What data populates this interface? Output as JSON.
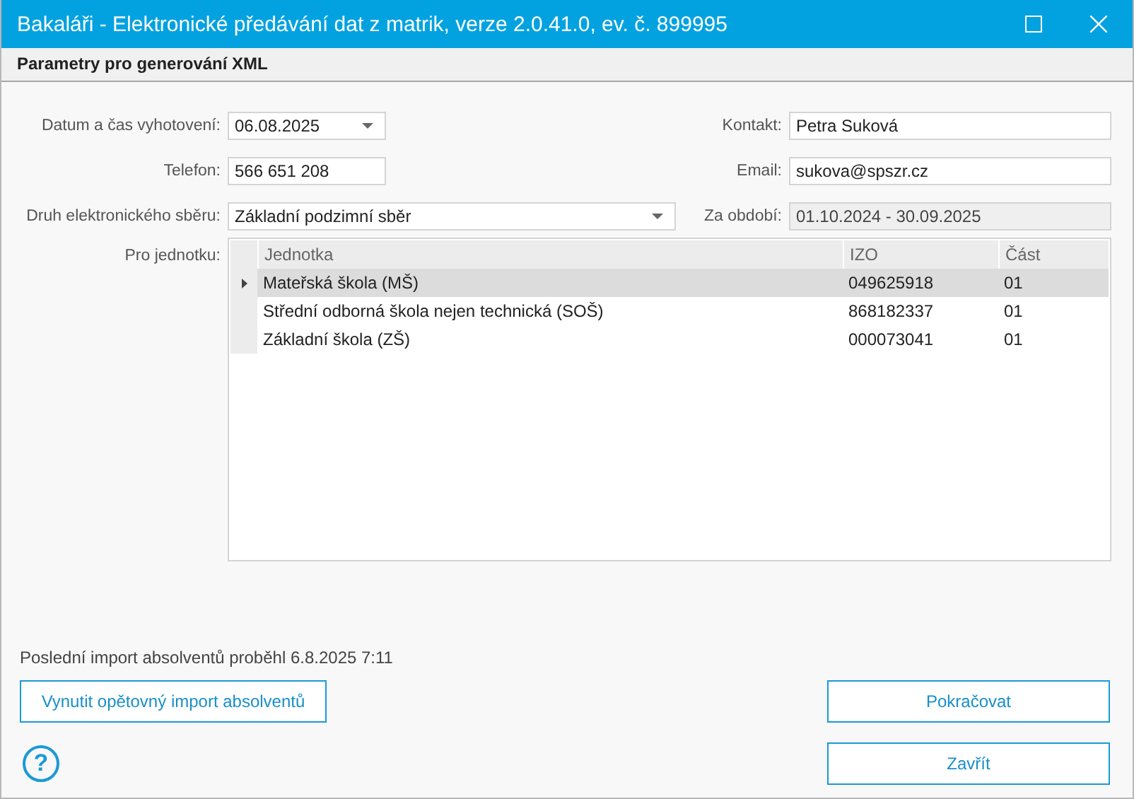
{
  "window": {
    "title": "Bakaláři - Elektronické předávání dat z matrik, verze 2.0.41.0, ev. č. 899995"
  },
  "tabs": [
    {
      "label": "Parametry pro generování XML",
      "selected": true
    }
  ],
  "form": {
    "date_label": "Datum a čas vyhotovení:",
    "date_value": "06.08.2025",
    "contact_label": "Kontakt:",
    "contact_value": "Petra Suková",
    "phone_label": "Telefon:",
    "phone_value": "566 651 208",
    "email_label": "Email:",
    "email_value": "sukova@spszr.cz",
    "collection_label": "Druh elektronického sběru:",
    "collection_value": "Základní podzimní sběr",
    "period_label": "Za období:",
    "period_value": "01.10.2024 - 30.09.2025",
    "period_disabled": true,
    "unit_label": "Pro jednotku:"
  },
  "table": {
    "columns": [
      "Jednotka",
      "IZO",
      "Část"
    ],
    "rows": [
      {
        "cells": [
          "Mateřská škola (MŠ)",
          "049625918",
          "01"
        ],
        "selected": true
      },
      {
        "cells": [
          "Střední odborná škola nejen technická (SOŠ)",
          "868182337",
          "01"
        ],
        "selected": false
      },
      {
        "cells": [
          "Základní škola (ZŠ)",
          "000073041",
          "01"
        ],
        "selected": false
      }
    ]
  },
  "status_text": "Poslední import absolventů proběhl 6.8.2025 7:11",
  "buttons": {
    "reimport": "Vynutit opětovný import absolventů",
    "continue": "Pokračovat",
    "close": "Zavřít"
  },
  "help_icon": "?"
}
